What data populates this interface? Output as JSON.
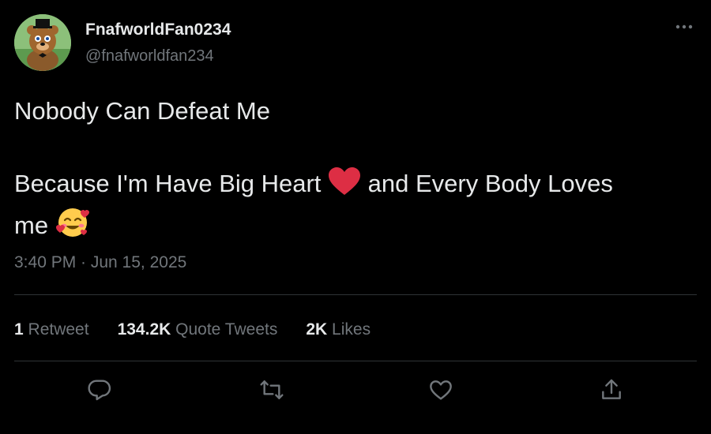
{
  "author": {
    "display_name": "FnafworldFan0234",
    "handle": "@fnafworldfan234"
  },
  "tweet": {
    "line1": "Nobody Can Defeat Me",
    "line2_part1": "Because I'm Have Big Heart",
    "line2_part2": " and Every Body Loves",
    "line3": "me",
    "timestamp": "3:40 PM · Jun 15, 2025"
  },
  "stats": {
    "retweets_count": "1",
    "retweets_label": "Retweet",
    "quotes_count": "134.2K",
    "quotes_label": "Quote Tweets",
    "likes_count": "2K",
    "likes_label": "Likes"
  },
  "icons": {
    "more": "more-horizontal-icon",
    "reply": "reply-icon",
    "retweet": "retweet-icon",
    "like": "heart-outline-icon",
    "share": "share-icon",
    "emoji_heart": "red-heart-emoji",
    "emoji_smile": "smiling-face-with-hearts-emoji"
  },
  "colors": {
    "background": "#000000",
    "primary_text": "#e7e9ea",
    "secondary_text": "#71767b",
    "divider": "#2f3336",
    "heart_red": "#dd2e44",
    "emoji_yellow": "#ffcc4d"
  }
}
